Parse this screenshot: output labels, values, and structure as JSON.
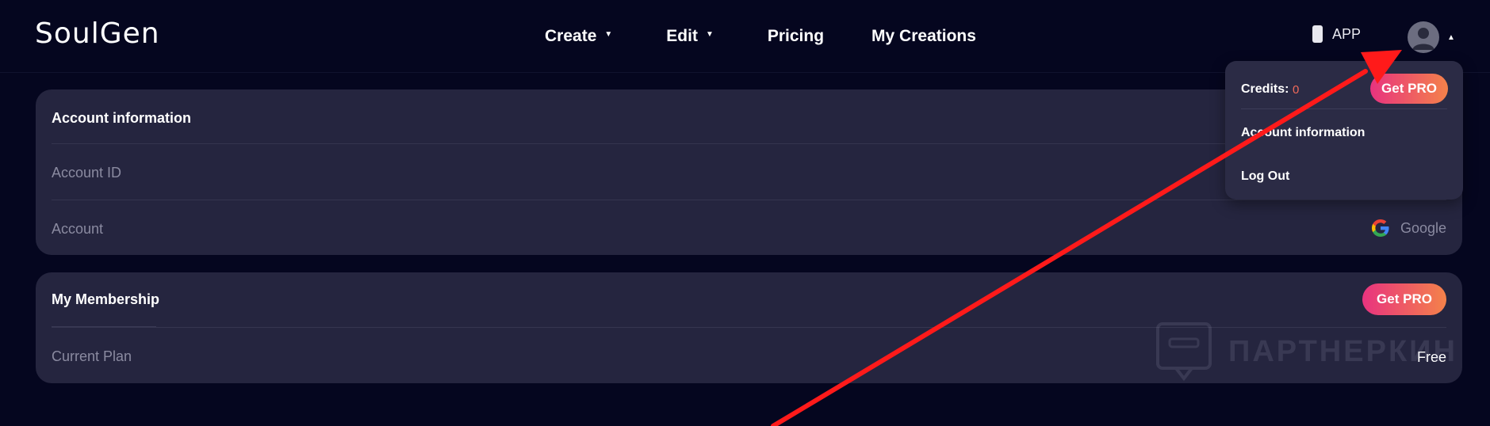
{
  "brand": {
    "logo_text": "SoulGen"
  },
  "nav": {
    "items": [
      {
        "label": "Create",
        "has_dropdown": true
      },
      {
        "label": "Edit",
        "has_dropdown": true
      },
      {
        "label": "Pricing",
        "has_dropdown": false
      },
      {
        "label": "My Creations",
        "has_dropdown": false
      }
    ]
  },
  "header": {
    "app_label": "APP",
    "app_icon": "phone-icon",
    "avatar_icon": "user-avatar-icon"
  },
  "account_card": {
    "title": "Account information",
    "rows": [
      {
        "label": "Account ID",
        "value": ""
      },
      {
        "label": "Account",
        "value": "Google",
        "icon": "google-icon"
      }
    ]
  },
  "membership_card": {
    "title": "My Membership",
    "get_pro_label": "Get PRO",
    "rows": [
      {
        "label": "Current Plan",
        "value": "Free"
      }
    ]
  },
  "dropdown_menu": {
    "credits_label": "Credits:",
    "credits_value": "0",
    "get_pro_label": "Get PRO",
    "items": [
      {
        "label": "Account information"
      },
      {
        "label": "Log Out"
      }
    ]
  },
  "watermark": {
    "text": "ПАРТНЕРКИН"
  },
  "colors": {
    "background": "#05061f",
    "card": "#25253f",
    "dropdown": "#2b2b45",
    "accent_gradient_start": "#e8337f",
    "accent_gradient_end": "#f4824a",
    "credits_value": "#f06a5a",
    "annotation_arrow": "#ff1a1a"
  }
}
